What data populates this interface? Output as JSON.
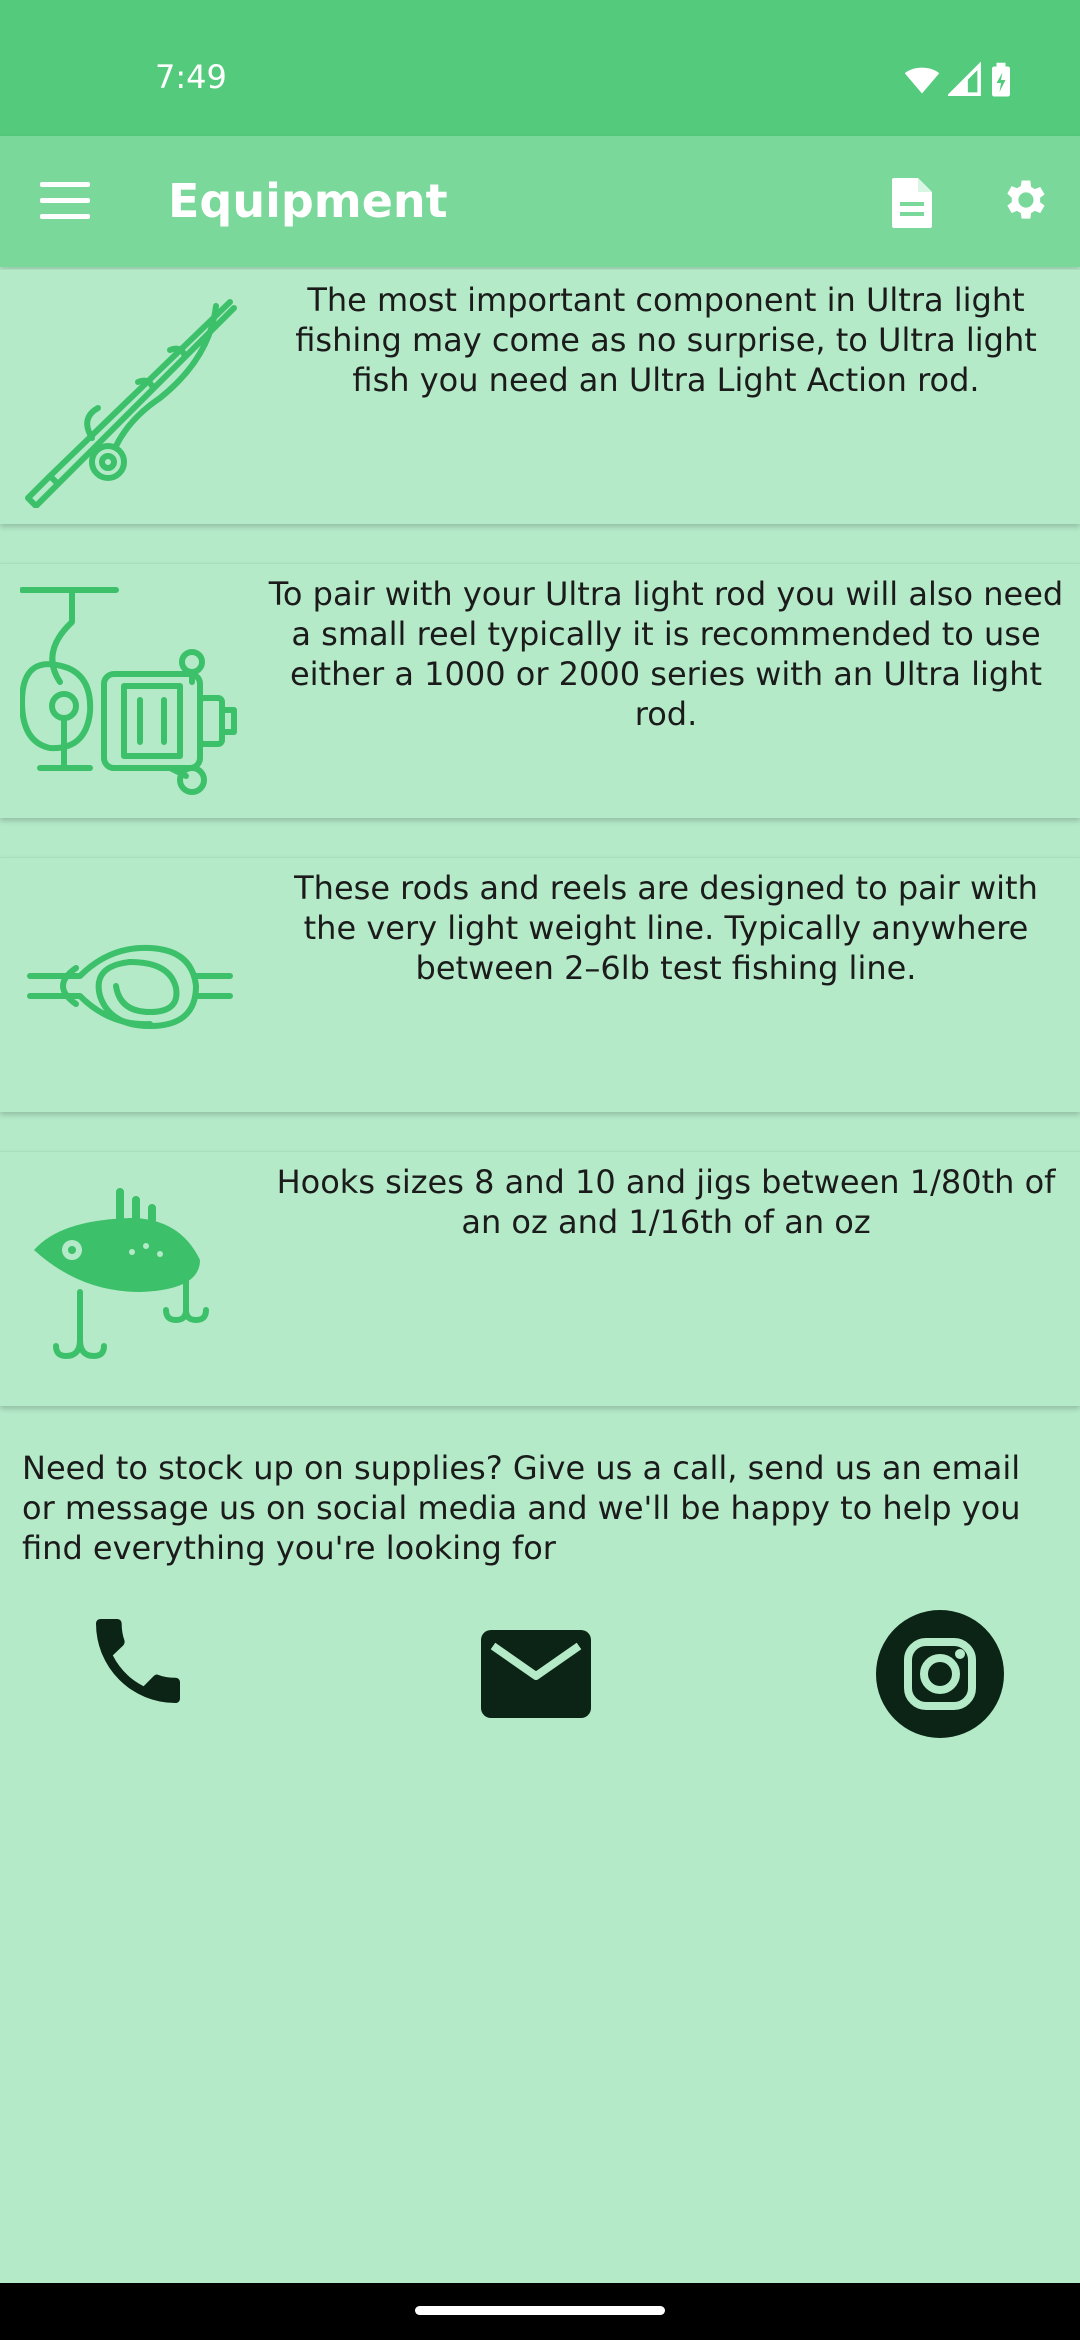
{
  "status_bar": {
    "time": "7:49"
  },
  "app_bar": {
    "title": "Equipment"
  },
  "cards": [
    {
      "icon": "fishing-rod-icon",
      "text": "The most important component in Ultra light fishing may come as no surprise, to Ultra light fish you need an Ultra Light Action rod."
    },
    {
      "icon": "fishing-reel-icon",
      "text": "To pair with your Ultra light rod you will also need a small reel typically it is recommended to use either a 1000 or 2000 series with an Ultra light rod."
    },
    {
      "icon": "knot-icon",
      "text": "These rods and reels are designed to pair with the very light weight line. Typically anywhere between 2–6lb test fishing line."
    },
    {
      "icon": "lure-icon",
      "text": "Hooks sizes 8 and 10 and jigs between 1/80th of an oz and 1/16th of an oz"
    }
  ],
  "footer": {
    "text": "Need to stock up on supplies? Give us a call, send us an email or message us on social media and we'll be happy to help you find everything you're looking for"
  },
  "contacts": [
    "phone-icon",
    "email-icon",
    "instagram-icon"
  ],
  "colors": {
    "status_bar": "#54cb7c",
    "app_bar": "#79d89a",
    "background": "#b4eac8",
    "icon_green": "#3cc06a",
    "dark_icon": "#0b2415"
  }
}
